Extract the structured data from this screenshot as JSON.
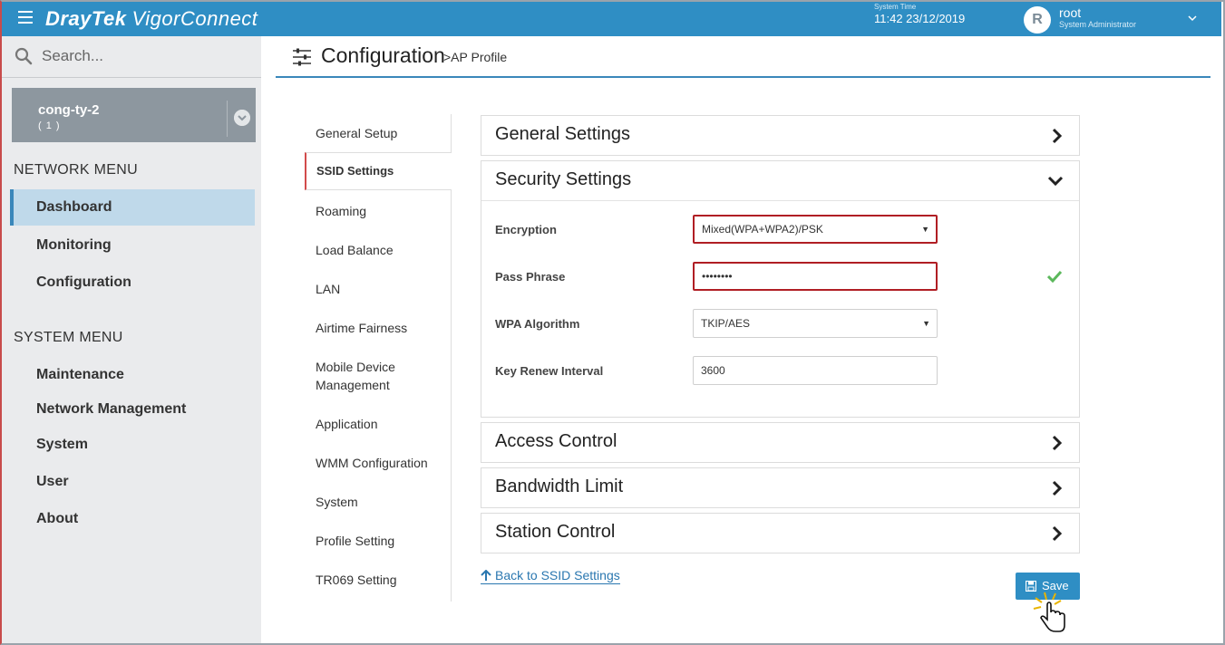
{
  "topbar": {
    "brand_dray": "Dray",
    "brand_tek": "Tek",
    "brand_product": "VigorConnect",
    "system_time_label": "System Time",
    "system_time": "11:42 23/12/2019",
    "avatar_letter": "R",
    "username": "root",
    "user_role": "System Administrator"
  },
  "sidebar": {
    "search_placeholder": "Search...",
    "site_name": "cong-ty-2",
    "site_count": "( 1 )",
    "network_menu_header": "NETWORK MENU",
    "network_items": [
      "Dashboard",
      "Monitoring",
      "Configuration"
    ],
    "system_menu_header": "SYSTEM MENU",
    "system_items": [
      "Maintenance",
      "Network Management",
      "System",
      "User",
      "About"
    ]
  },
  "header": {
    "title": "Configuration",
    "subtitle": ">AP Profile"
  },
  "subnav": {
    "items": [
      "General Setup",
      "SSID Settings",
      "Roaming",
      "Load Balance",
      "LAN",
      "Airtime Fairness",
      "Mobile Device Management",
      "Application",
      "WMM Configuration",
      "System",
      "Profile Setting",
      "TR069 Setting"
    ],
    "active": "SSID Settings"
  },
  "panels": {
    "general": "General Settings",
    "security": "Security Settings",
    "access": "Access Control",
    "bandwidth": "Bandwidth Limit",
    "station": "Station Control"
  },
  "security": {
    "encryption_label": "Encryption",
    "encryption_value": "Mixed(WPA+WPA2)/PSK",
    "passphrase_label": "Pass Phrase",
    "passphrase_value": "••••••••",
    "wpa_label": "WPA Algorithm",
    "wpa_value": "TKIP/AES",
    "renew_label": "Key Renew Interval",
    "renew_value": "3600"
  },
  "actions": {
    "back_label": "Back to SSID Settings",
    "save_label": "Save"
  },
  "colors": {
    "topbar": "#2f8ec4",
    "sidebar_bg": "#eaebed",
    "active_item_bg": "#bfd9ea",
    "error_border": "#b01e24",
    "check_green": "#5cb85c"
  }
}
